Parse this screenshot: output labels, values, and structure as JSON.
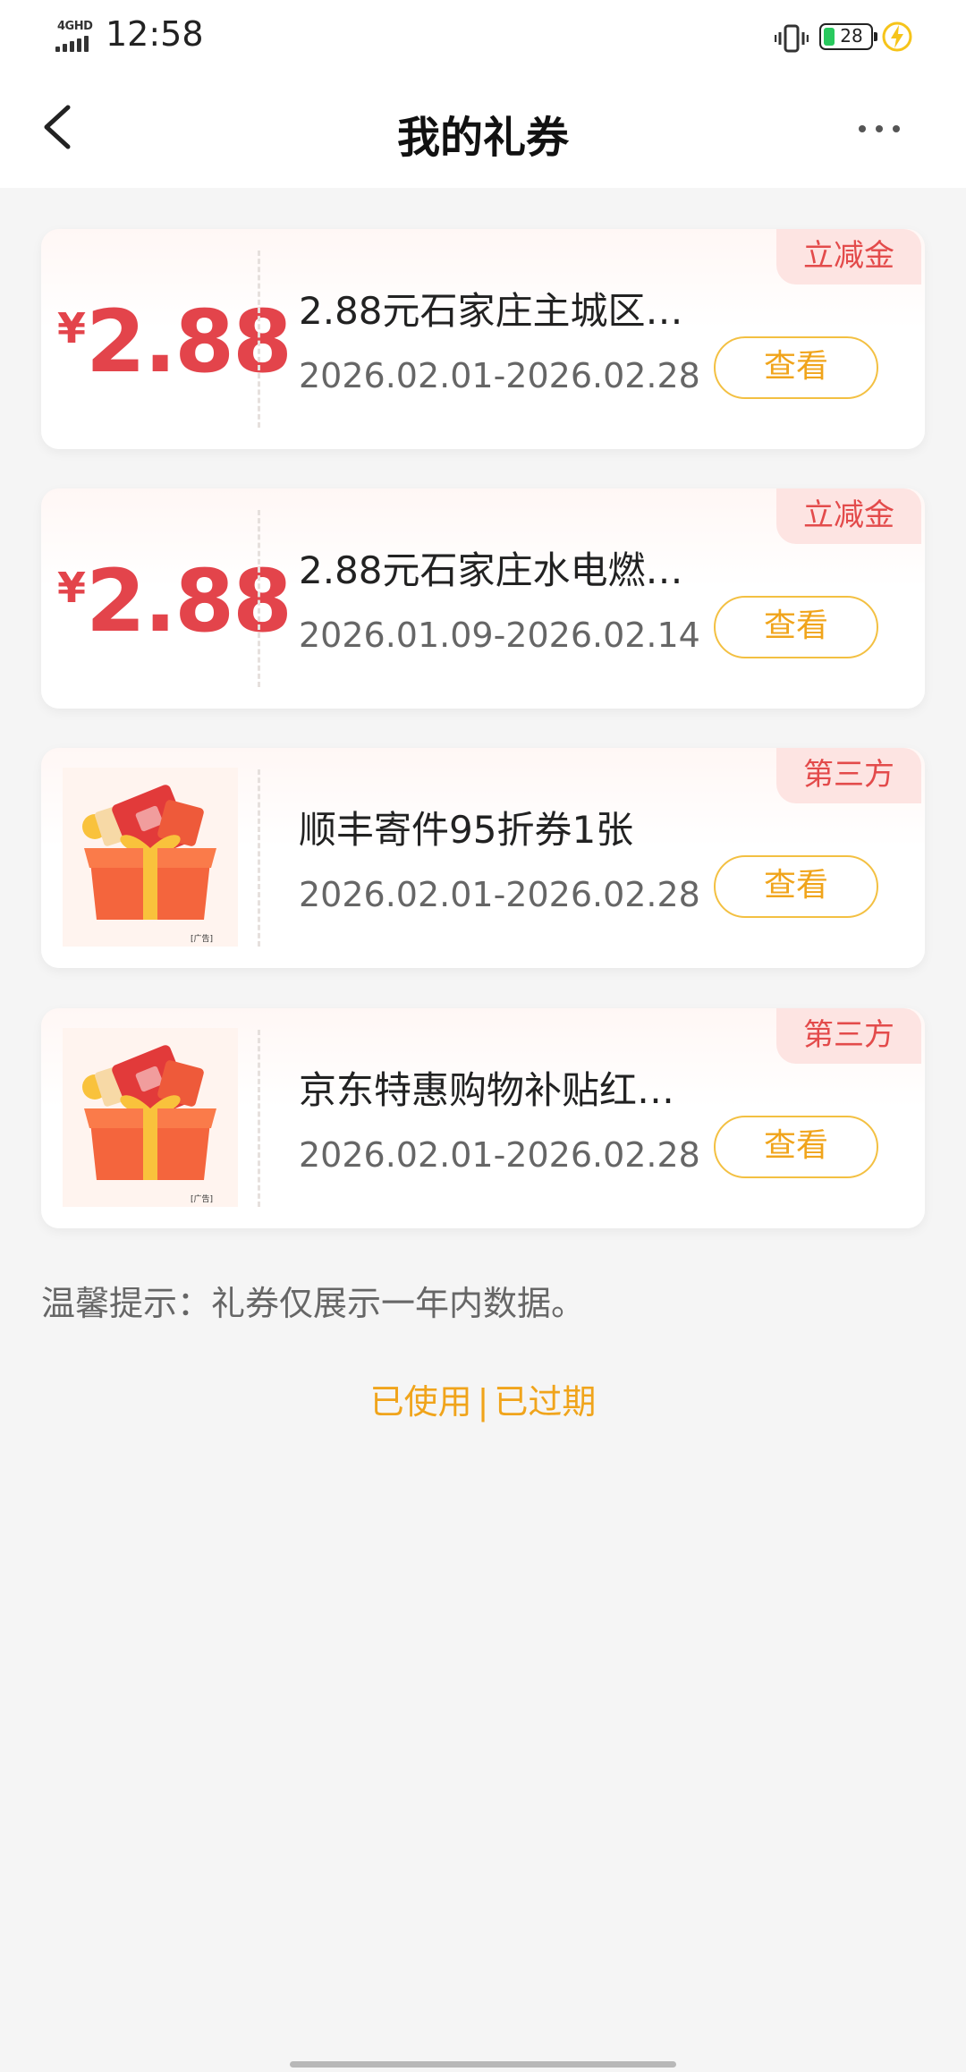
{
  "status_bar": {
    "network": "4GHD",
    "time": "12:58",
    "battery": "28",
    "battery_level": 0.28
  },
  "header": {
    "title": "我的礼券"
  },
  "coupons": [
    {
      "tag": "立减金",
      "currency": "¥",
      "amount": "2.88",
      "title": "2.88元石家庄主城区…",
      "date": "2026.02.01-2026.02.28",
      "button": "查看"
    },
    {
      "tag": "立减金",
      "currency": "¥",
      "amount": "2.88",
      "title": "2.88元石家庄水电燃…",
      "date": "2026.01.09-2026.02.14",
      "button": "查看"
    },
    {
      "tag": "第三方",
      "image": "gift-box-image",
      "ad_label": "[广告]",
      "title": "顺丰寄件95折券1张",
      "date": "2026.02.01-2026.02.28",
      "button": "查看"
    },
    {
      "tag": "第三方",
      "image": "gift-box-image",
      "ad_label": "[广告]",
      "title": "京东特惠购物补贴红…",
      "date": "2026.02.01-2026.02.28",
      "button": "查看"
    }
  ],
  "tip": "温馨提示：礼券仅展示一年内数据。",
  "links": {
    "used": "已使用",
    "separator": "|",
    "expired": "已过期"
  },
  "colors": {
    "accent": "#f0a41b",
    "price": "#e3444b",
    "tag_bg": "#fde4e2"
  }
}
